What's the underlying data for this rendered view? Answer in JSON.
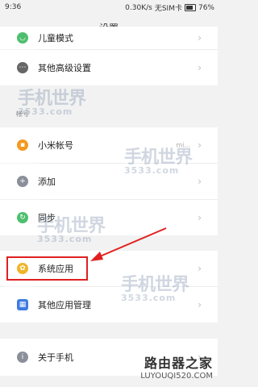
{
  "status_bar": {
    "time": "9:36",
    "speed": "0.30K/s",
    "sim": "无SIM卡",
    "battery": "76%",
    "battery_level": 0.76
  },
  "header": {
    "title": "设置"
  },
  "rows": [
    {
      "label": "儿童模式",
      "icon": "child-mode-icon",
      "color": "#4fbf6f"
    },
    {
      "label": "其他高级设置",
      "icon": "more-dots-icon",
      "color": "#666666"
    },
    {
      "label": "小米帐号",
      "icon": "mi-account-icon",
      "color": "#f39a1f",
      "value": "mi..."
    },
    {
      "label": "添加",
      "icon": "plus-icon",
      "color": "#8a8f99"
    },
    {
      "label": "同步",
      "icon": "sync-icon",
      "color": "#4fbf6f"
    },
    {
      "label": "系统应用",
      "icon": "system-apps-icon",
      "color": "#f0b429"
    },
    {
      "label": "其他应用管理",
      "icon": "apps-grid-icon",
      "color": "#3f7be0"
    },
    {
      "label": "关于手机",
      "icon": "info-icon",
      "color": "#8a8f99"
    }
  ],
  "section_account": "帐号",
  "watermark": {
    "main": "手机世界",
    "sub": "3533.com"
  },
  "footer": {
    "brand": "路由器之家",
    "url": "LUYOUQI520.COM"
  }
}
